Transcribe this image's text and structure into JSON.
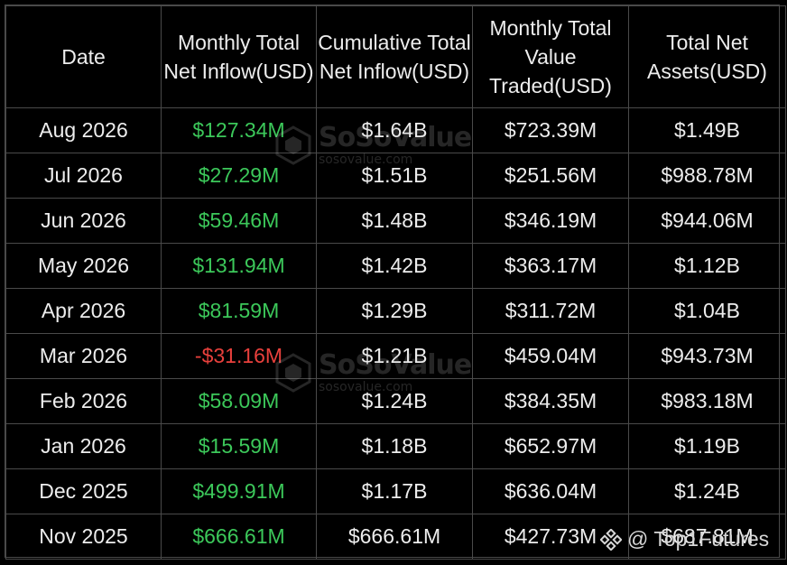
{
  "table": {
    "headers": {
      "date": "Date",
      "monthly_net_inflow": "Monthly Total Net Inflow(USD)",
      "cumulative_net_inflow": "Cumulative Total Net Inflow(USD)",
      "monthly_value_traded": "Monthly Total Value Traded(USD)",
      "total_net_assets": "Total Net Assets(USD)"
    },
    "rows": [
      {
        "date": "Aug 2026",
        "net_inflow": "$127.34M",
        "cumulative": "$1.64B",
        "value_traded": "$723.39M",
        "net_assets": "$1.49B"
      },
      {
        "date": "Jul 2026",
        "net_inflow": "$27.29M",
        "cumulative": "$1.51B",
        "value_traded": "$251.56M",
        "net_assets": "$988.78M"
      },
      {
        "date": "Jun 2026",
        "net_inflow": "$59.46M",
        "cumulative": "$1.48B",
        "value_traded": "$346.19M",
        "net_assets": "$944.06M"
      },
      {
        "date": "May 2026",
        "net_inflow": "$131.94M",
        "cumulative": "$1.42B",
        "value_traded": "$363.17M",
        "net_assets": "$1.12B"
      },
      {
        "date": "Apr 2026",
        "net_inflow": "$81.59M",
        "cumulative": "$1.29B",
        "value_traded": "$311.72M",
        "net_assets": "$1.04B"
      },
      {
        "date": "Mar 2026",
        "net_inflow": "-$31.16M",
        "cumulative": "$1.21B",
        "value_traded": "$459.04M",
        "net_assets": "$943.73M"
      },
      {
        "date": "Feb 2026",
        "net_inflow": "$58.09M",
        "cumulative": "$1.24B",
        "value_traded": "$384.35M",
        "net_assets": "$983.18M"
      },
      {
        "date": "Jan 2026",
        "net_inflow": "$15.59M",
        "cumulative": "$1.18B",
        "value_traded": "$652.97M",
        "net_assets": "$1.19B"
      },
      {
        "date": "Dec 2025",
        "net_inflow": "$499.91M",
        "cumulative": "$1.17B",
        "value_traded": "$636.04M",
        "net_assets": "$1.24B"
      },
      {
        "date": "Nov 2025",
        "net_inflow": "$666.61M",
        "cumulative": "$666.61M",
        "value_traded": "$427.73M",
        "net_assets": "$687.81M"
      }
    ]
  },
  "watermark": {
    "title": "SoSoValue",
    "subtitle": "sosovalue.com"
  },
  "credit": {
    "handle": "@ Top1Futures",
    "icon": "binance-logo-icon"
  },
  "colors": {
    "background": "#000000",
    "positive": "#3cc85a",
    "negative": "#e8403c",
    "text": "#ededed",
    "border": "#4a4a4a"
  }
}
